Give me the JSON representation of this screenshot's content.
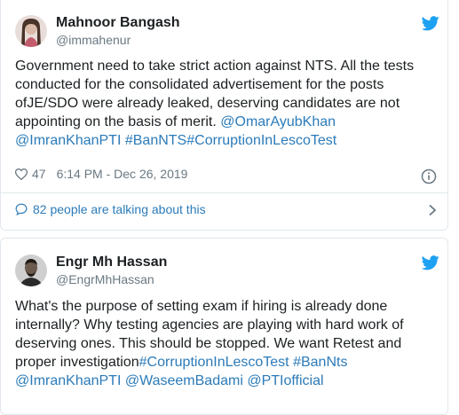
{
  "colors": {
    "link": "#2b7bb9",
    "text": "#1c2022",
    "secondary": "#697882",
    "twitter_blue": "#1da1f2",
    "border": "#e1e8ed"
  },
  "tweets": [
    {
      "author_name": "Mahnoor Bangash",
      "author_handle": "@immahenur",
      "body": [
        {
          "t": "text",
          "v": "Government need to take strict action against NTS. All the tests conducted for the consolidated advertisement for the posts ofJE/SDO were already leaked, deserving candidates are not appointing on the basis of merit. "
        },
        {
          "t": "link",
          "v": "@OmarAyubKhan"
        },
        {
          "t": "text",
          "v": " "
        },
        {
          "t": "link",
          "v": "@ImranKhanPTI"
        },
        {
          "t": "text",
          "v": " "
        },
        {
          "t": "link",
          "v": "#BanNTS"
        },
        {
          "t": "link",
          "v": "#CorruptionInLescoTest"
        }
      ],
      "likes": "47",
      "timestamp": "6:14 PM - Dec 26, 2019",
      "talking": "82 people are talking about this",
      "icons": {
        "heart": "heart-icon",
        "info": "info-icon",
        "bubble": "comment-bubble-icon",
        "chevron": "chevron-right-icon",
        "bird": "twitter-bird-icon"
      }
    },
    {
      "author_name": "Engr Mh Hassan",
      "author_handle": "@EngrMhHassan",
      "body": [
        {
          "t": "text",
          "v": "What's the purpose of setting exam if hiring is already done internally? Why testing agencies are playing with hard work of deserving ones. This should be stopped. We want Retest and proper investigation"
        },
        {
          "t": "link",
          "v": "#CorruptionInLescoTest"
        },
        {
          "t": "text",
          "v": " "
        },
        {
          "t": "link",
          "v": "#BanNts"
        },
        {
          "t": "text",
          "v": " "
        },
        {
          "t": "link",
          "v": "@ImranKhanPTI"
        },
        {
          "t": "text",
          "v": " "
        },
        {
          "t": "link",
          "v": "@WaseemBadami"
        },
        {
          "t": "text",
          "v": " "
        },
        {
          "t": "link",
          "v": "@PTIofficial"
        }
      ],
      "icons": {
        "bird": "twitter-bird-icon"
      }
    }
  ]
}
